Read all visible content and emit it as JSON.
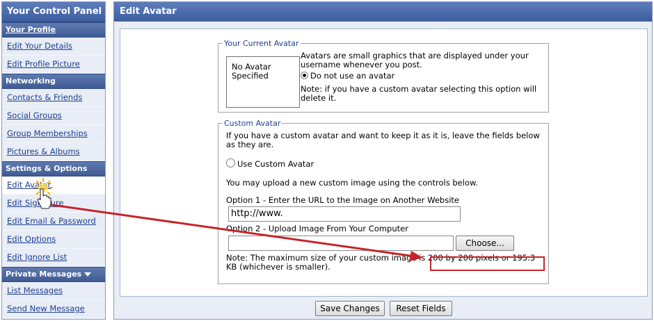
{
  "sidebar": {
    "title": "Your Control Panel",
    "sections": [
      {
        "heading": "Your Profile",
        "items": [
          "Edit Your Details",
          "Edit Profile Picture"
        ]
      },
      {
        "heading": "Networking",
        "items": [
          "Contacts & Friends",
          "Social Groups",
          "Group Memberships",
          "Pictures & Albums"
        ]
      },
      {
        "heading": "Settings & Options",
        "items": [
          "Edit Avatar",
          "Edit Signature",
          "Edit Email & Password",
          "Edit Options",
          "Edit Ignore List"
        ]
      },
      {
        "heading": "Private Messages",
        "items": [
          "List Messages",
          "Send New Message"
        ]
      }
    ]
  },
  "main": {
    "title": "Edit Avatar",
    "current": {
      "legend": "Your Current Avatar",
      "no_avatar": "No Avatar Specified",
      "description": "Avatars are small graphics that are displayed under your username whenever you post.",
      "option_label": "Do not use an avatar",
      "note": "Note: if you have a custom avatar selecting this option will delete it."
    },
    "custom": {
      "legend": "Custom Avatar",
      "intro": "If you have a custom avatar and want to keep it as it is, leave the fields below as they are.",
      "use_custom_label": "Use Custom Avatar",
      "upload_hint": "You may upload a new custom image using the controls below.",
      "option1_label": "Option 1 - Enter the URL to the Image on Another Website",
      "url_value": "http://www.",
      "option2_label": "Option 2 - Upload Image From Your Computer",
      "file_value": "",
      "choose_label": "Choose...",
      "note_line1": "Note: The maximum size of your custom image is 200 by 200 pixels or 195.3",
      "note_line2": "KB (whichever is smaller)."
    },
    "buttons": {
      "save": "Save Changes",
      "reset": "Reset Fields"
    }
  },
  "colors": {
    "header": "#3c5d9e",
    "link": "#1d3f8f",
    "annotation": "#c8232a"
  }
}
